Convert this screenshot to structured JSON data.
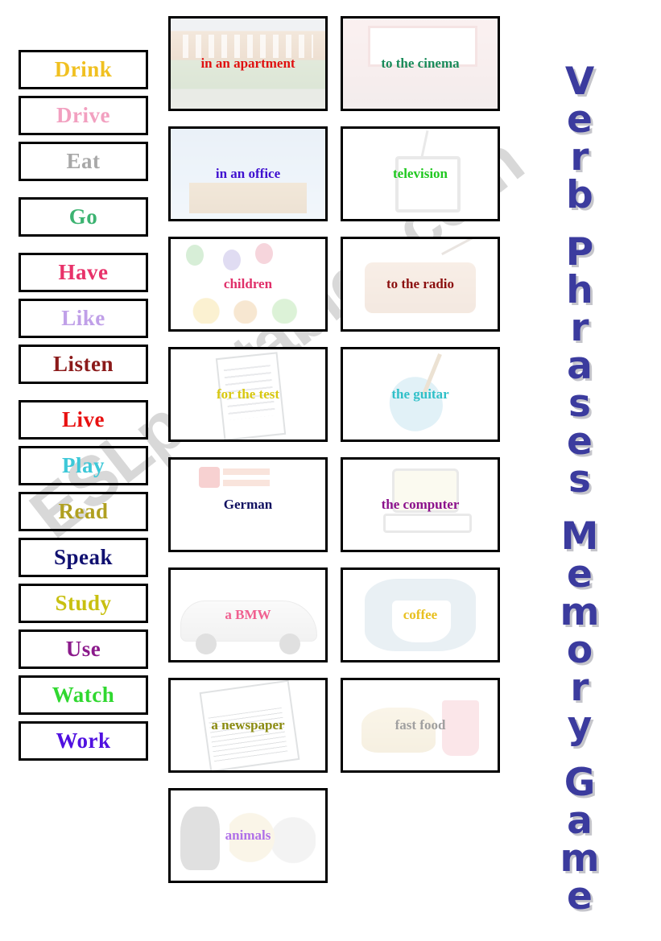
{
  "watermark": {
    "text": "ESLprintables.com"
  },
  "title": {
    "full_text": "Verb Phrases Memory Game",
    "words": [
      "Verb",
      "Phrases",
      "Memory",
      "Game"
    ],
    "color": "#3b3b9e"
  },
  "verb_column": {
    "items": [
      {
        "label": "Drink",
        "color": "#f0c020"
      },
      {
        "label": "Drive",
        "color": "#f2a0c0"
      },
      {
        "label": "Eat",
        "color": "#a8a8a8"
      },
      {
        "label": "Go",
        "color": "#3cb371"
      },
      {
        "label": "Have",
        "color": "#e8326a"
      },
      {
        "label": "Like",
        "color": "#c0a0e8"
      },
      {
        "label": "Listen",
        "color": "#8b1a1a"
      },
      {
        "label": "Live",
        "color": "#e81010"
      },
      {
        "label": "Play",
        "color": "#3ec8d8"
      },
      {
        "label": "Read",
        "color": "#b0a020"
      },
      {
        "label": "Speak",
        "color": "#101070"
      },
      {
        "label": "Study",
        "color": "#c8c010"
      },
      {
        "label": "Use",
        "color": "#8b1a8b"
      },
      {
        "label": "Watch",
        "color": "#30d830"
      },
      {
        "label": "Work",
        "color": "#5010e0"
      }
    ]
  },
  "picture_grid": {
    "rows": [
      [
        {
          "label": "in an apartment",
          "color": "#e01010",
          "art": "art-apartment"
        },
        {
          "label": "to the cinema",
          "color": "#1a8b5a",
          "art": "art-cinema"
        }
      ],
      [
        {
          "label": "in an office",
          "color": "#4010d0",
          "art": "art-office"
        },
        {
          "label": "television",
          "color": "#20c820",
          "art": "art-television"
        }
      ],
      [
        {
          "label": "children",
          "color": "#e0306a",
          "art": "art-children"
        },
        {
          "label": "to the radio",
          "color": "#8b1010",
          "art": "art-radio"
        }
      ],
      [
        {
          "label": "for the test",
          "color": "#d8c810",
          "art": "art-test"
        },
        {
          "label": "the guitar",
          "color": "#30c0c8",
          "art": "art-guitar"
        }
      ],
      [
        {
          "label": "German",
          "color": "#101060",
          "art": "art-german"
        },
        {
          "label": "the computer",
          "color": "#8b108b",
          "art": "art-computer"
        }
      ],
      [
        {
          "label": "a BMW",
          "color": "#f06090",
          "art": "art-bmw"
        },
        {
          "label": "coffee",
          "color": "#e8c020",
          "art": "art-coffee"
        }
      ],
      [
        {
          "label": "a newspaper",
          "color": "#8b8b10",
          "art": "art-newspaper"
        },
        {
          "label": "fast food",
          "color": "#a0a0a0",
          "art": "art-fastfood"
        }
      ],
      [
        {
          "label": "animals",
          "color": "#b070e8",
          "art": "art-animals"
        },
        {
          "label": "",
          "color": "",
          "art": ""
        }
      ]
    ]
  }
}
